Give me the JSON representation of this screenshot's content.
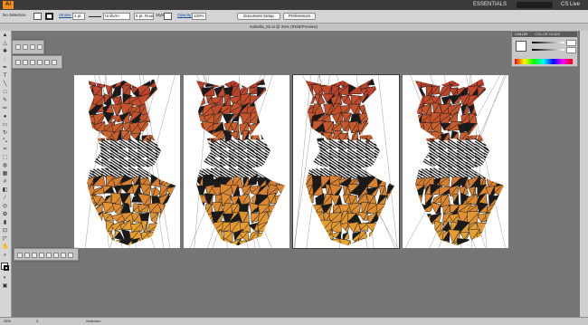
{
  "menubar": {
    "app_icon": "Ai",
    "workspace": "ESSENTIALS",
    "account": "CS Live"
  },
  "control_bar": {
    "selection": "No Selection",
    "stroke_label": "Stroke:",
    "stroke_weight": "1 pt",
    "profile": "Uniform",
    "brush": "5 pt. Round",
    "style_label": "Style:",
    "opacity_label": "Opacity:",
    "opacity_value": "100%",
    "document_setup": "Document Setup",
    "preferences": "Preferences"
  },
  "document": {
    "tab_title": "Isabella_02.ai @ 25% (RGB/Preview)"
  },
  "color_panel": {
    "tab_color": "COLOR",
    "tab_guide": "COLOR GUIDE"
  },
  "status_bar": {
    "zoom": "25%",
    "artboard": "3",
    "tool": "Selection"
  },
  "art": {
    "colors": {
      "top": "#b93a2a",
      "bottom": "#e8a534",
      "ink": "#1a1a1a"
    },
    "artboards": [
      {
        "name": "artboard-1",
        "active": false
      },
      {
        "name": "artboard-2",
        "active": false
      },
      {
        "name": "artboard-3",
        "active": true
      },
      {
        "name": "artboard-4",
        "active": false
      }
    ]
  }
}
